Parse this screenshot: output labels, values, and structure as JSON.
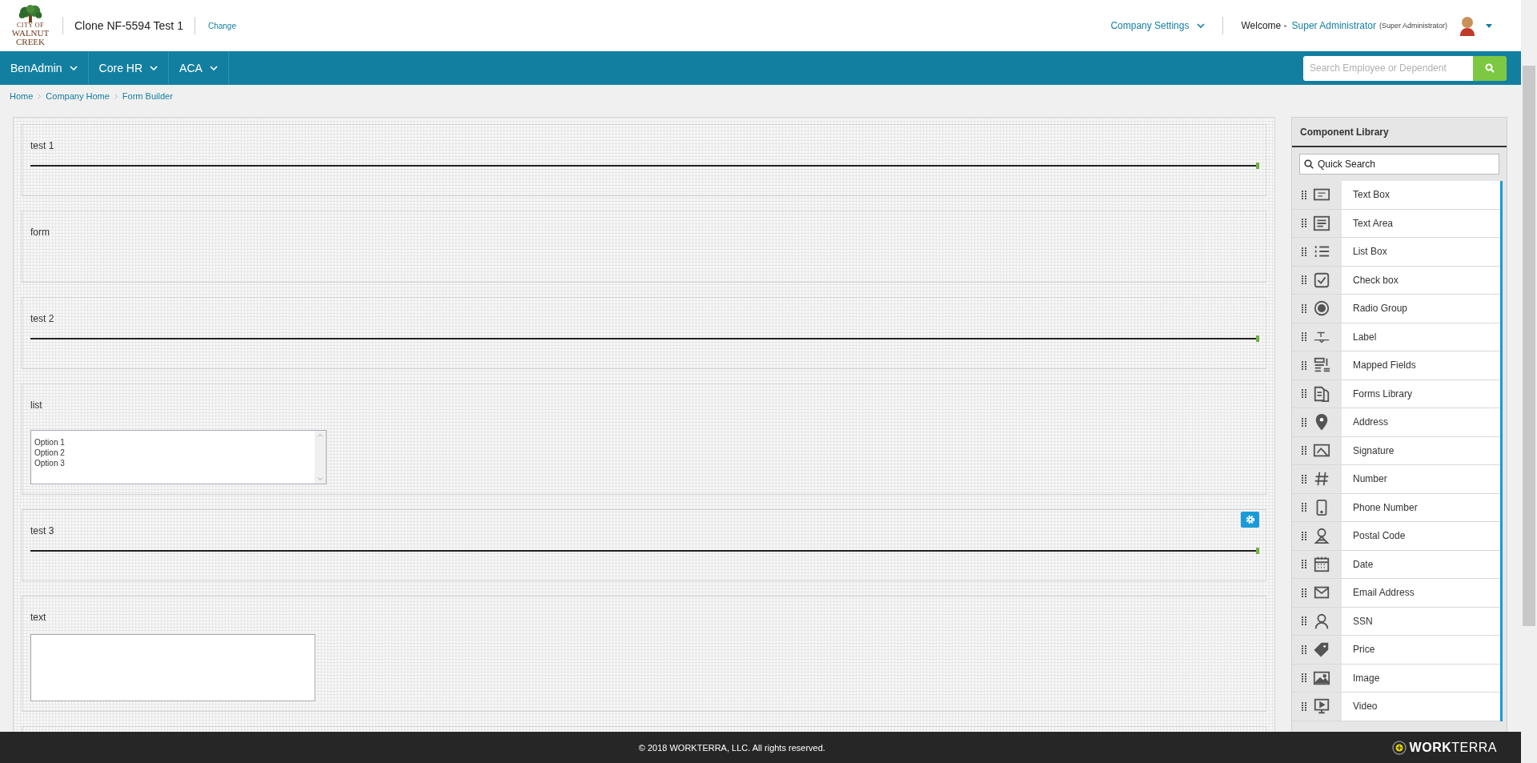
{
  "header": {
    "logo": {
      "lines": [
        "CITY OF",
        "WALNUT",
        "CREEK"
      ]
    },
    "company": "Clone NF-5594 Test 1",
    "change_link": "Change",
    "company_settings": "Company Settings",
    "welcome": "Welcome -",
    "user": "Super Administrator",
    "role": "(Super Administrator)"
  },
  "nav": {
    "menus": [
      {
        "label": "BenAdmin"
      },
      {
        "label": "Core HR"
      },
      {
        "label": "ACA"
      }
    ],
    "search": {
      "placeholder": "Search Employee or Dependent"
    }
  },
  "breadcrumb": [
    "Home",
    "Company Home",
    "Form Builder"
  ],
  "sections": [
    {
      "label": "test 1",
      "kind": "line",
      "selected": false
    },
    {
      "label": "form",
      "kind": "blank",
      "selected": false
    },
    {
      "label": "test 2",
      "kind": "line",
      "selected": false
    },
    {
      "label": "list",
      "kind": "listbox",
      "selected": false,
      "options": [
        "Option 1",
        "Option 2",
        "Option 3"
      ]
    },
    {
      "label": "test 3",
      "kind": "line",
      "selected": true
    },
    {
      "label": "text",
      "kind": "textarea",
      "selected": false
    },
    {
      "kind": "blank",
      "selected": false
    }
  ],
  "library": {
    "title": "Component Library",
    "search": {
      "placeholder": "Quick Search"
    },
    "items": [
      {
        "label": "Text Box"
      },
      {
        "label": "Text Area"
      },
      {
        "label": "List Box"
      },
      {
        "label": "Check box"
      },
      {
        "label": "Radio Group"
      },
      {
        "label": "Label"
      },
      {
        "label": "Mapped Fields"
      },
      {
        "label": "Forms Library"
      },
      {
        "label": "Address"
      },
      {
        "label": "Signature"
      },
      {
        "label": "Number"
      },
      {
        "label": "Phone Number"
      },
      {
        "label": "Postal Code"
      },
      {
        "label": "Date"
      },
      {
        "label": "Email Address"
      },
      {
        "label": "SSN"
      },
      {
        "label": "Price"
      },
      {
        "label": "Image"
      },
      {
        "label": "Video"
      }
    ]
  },
  "footer": {
    "copyright": "© 2018 WORKTERRA, LLC. All rights reserved.",
    "brand": "**WORK**TERRA"
  }
}
